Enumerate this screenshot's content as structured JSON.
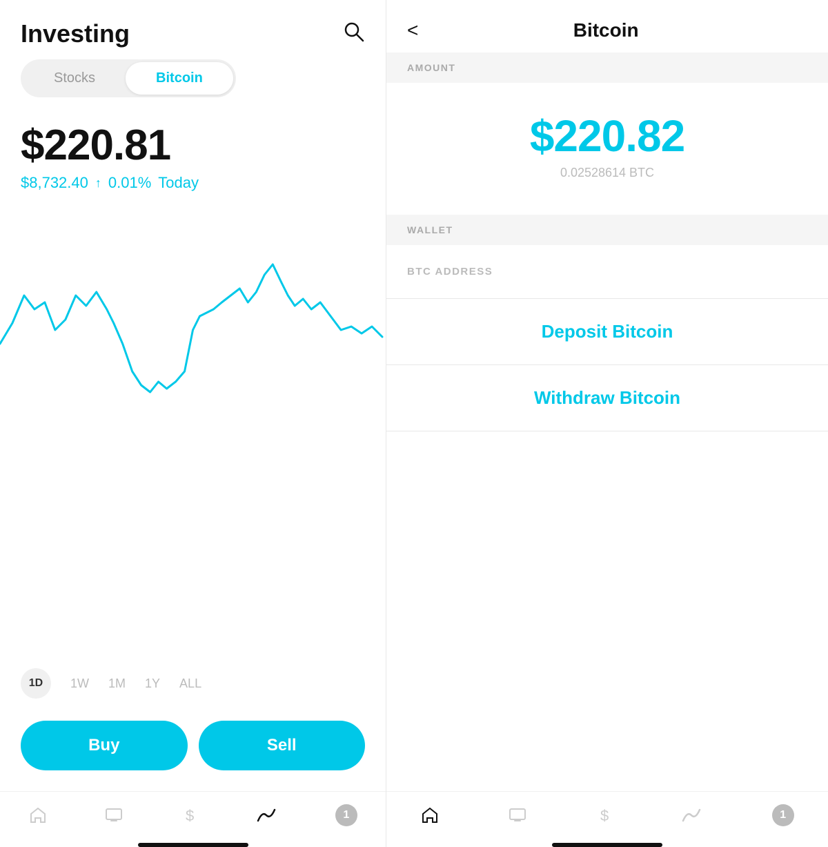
{
  "left": {
    "title": "Investing",
    "tabs": [
      {
        "label": "Stocks",
        "active": false
      },
      {
        "label": "Bitcoin",
        "active": true
      }
    ],
    "price": "$220.81",
    "btc_price": "$8,732.40",
    "change_arrow": "↑",
    "change_pct": "0.01%",
    "today": "Today",
    "time_filters": [
      "1D",
      "1W",
      "1M",
      "1Y",
      "ALL"
    ],
    "active_filter": "1D",
    "buy_label": "Buy",
    "sell_label": "Sell",
    "nav_icons": [
      "home",
      "tv",
      "dollar",
      "chart",
      "notification"
    ],
    "notification_count": "1"
  },
  "right": {
    "back_label": "<",
    "title": "Bitcoin",
    "amount_label": "AMOUNT",
    "amount_usd": "$220.82",
    "amount_btc": "0.02528614 BTC",
    "wallet_label": "WALLET",
    "btc_address_label": "BTC ADDRESS",
    "deposit_label": "Deposit Bitcoin",
    "withdraw_label": "Withdraw Bitcoin",
    "nav_icons": [
      "home",
      "tv",
      "dollar",
      "chart",
      "notification"
    ],
    "notification_count": "1"
  },
  "colors": {
    "accent": "#00c8e8",
    "text_primary": "#111",
    "text_secondary": "#aaa",
    "bg_section": "#f5f5f5"
  }
}
